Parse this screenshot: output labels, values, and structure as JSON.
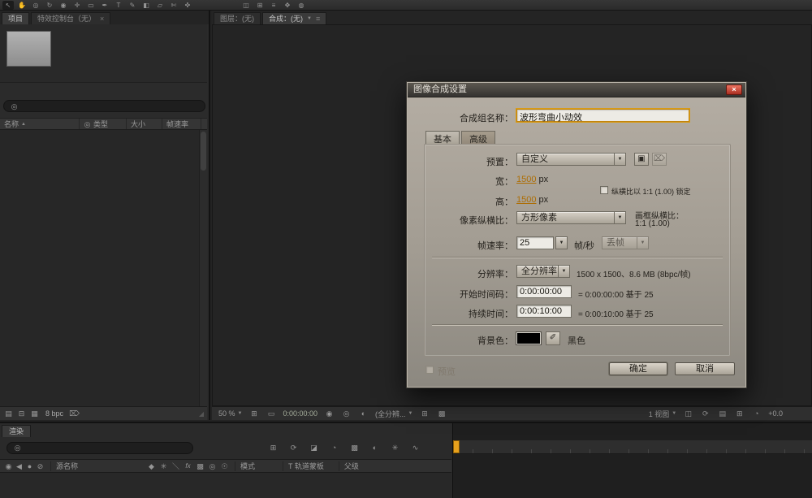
{
  "ui": {
    "dropdown_arrow": "▼",
    "sort_asc": "▲",
    "close_glyph": "×",
    "search_glyph": "◎",
    "panel_menu_glyph": "≡",
    "grip_glyph": "◢",
    "save_glyph": "▣",
    "trash_glyph": "⌦"
  },
  "toolbar": {
    "tools": [
      {
        "glyph": "↖"
      },
      {
        "glyph": "✋"
      },
      {
        "glyph": "◎"
      },
      {
        "glyph": "↻"
      },
      {
        "glyph": "◉"
      },
      {
        "glyph": "✛"
      },
      {
        "glyph": "▭"
      },
      {
        "glyph": "✒"
      },
      {
        "glyph": "T"
      },
      {
        "glyph": "✎"
      },
      {
        "glyph": "◧"
      },
      {
        "glyph": "▱"
      },
      {
        "glyph": "✄"
      },
      {
        "glyph": "✜"
      }
    ],
    "extras": [
      {
        "glyph": "◫"
      },
      {
        "glyph": "⊞"
      },
      {
        "glyph": "≡"
      },
      {
        "glyph": "✥"
      },
      {
        "glyph": "◍"
      }
    ]
  },
  "project": {
    "tab_label": "项目",
    "effect_tab_label": "特效控制台（无）",
    "columns": [
      "名称",
      "类型",
      "大小",
      "帧速率"
    ],
    "bpc_label": "8 bpc",
    "bottom_icons": [
      {
        "glyph": "▤"
      },
      {
        "glyph": "⊟"
      },
      {
        "glyph": "▦"
      },
      {
        "glyph": "⌦"
      }
    ]
  },
  "viewer": {
    "layer_tab": "图层：(无)",
    "comp_tab": "合成：(无)",
    "zoom": "50 %",
    "timecode": "0:00:00:00",
    "resolution": "(全分辨...",
    "view_layout": "1 视图",
    "exposure": "+0.0"
  },
  "dialog": {
    "title": "图像合成设置",
    "name_label": "合成组名称：",
    "name_value": "波形弯曲小动效",
    "tab_basic": "基本",
    "tab_advanced": "高级",
    "preset_label": "预置：",
    "preset_value": "自定义",
    "width_label": "宽：",
    "width_value": "1500",
    "width_unit": "px",
    "lock_label": "纵横比以 1:1 (1.00) 锁定",
    "height_label": "高：",
    "height_value": "1500",
    "height_unit": "px",
    "par_label": "像素纵横比：",
    "par_value": "方形像素",
    "frame_ar_label": "画框纵横比：",
    "frame_ar_value": "1:1 (1.00)",
    "fps_label": "帧速率：",
    "fps_value": "25",
    "fps_unit": "帧/秒",
    "dropframe_value": "丢帧",
    "res_label": "分辨率：",
    "res_value": "全分辨率",
    "res_info": "1500 x 1500、8.6 MB (8bpc/帧)",
    "start_label": "开始时间码：",
    "start_value": "0:00:00:00",
    "start_info": "= 0:00:00:00 基于 25",
    "dur_label": "持续时间：",
    "dur_value": "0:00:10:00",
    "dur_info": "= 0:00:10:00 基于 25",
    "bg_label": "背景色：",
    "bg_name": "黑色",
    "eyedropper_glyph": "✐",
    "preview_label": "预览",
    "ok_label": "确定",
    "cancel_label": "取消"
  },
  "timeline": {
    "tab_label": "渲染",
    "source_name_col": "源名称",
    "mode_col": "模式",
    "track_matte_col": "T 轨道蒙板",
    "parent_col": "父级",
    "toolbar_icons": [
      {
        "glyph": "⊞"
      },
      {
        "glyph": "⟳"
      },
      {
        "glyph": "◪"
      },
      {
        "glyph": "◔"
      },
      {
        "glyph": "▩"
      },
      {
        "glyph": "◐"
      },
      {
        "glyph": "✳"
      },
      {
        "glyph": "∿"
      }
    ],
    "av_icons": [
      {
        "glyph": "◉"
      },
      {
        "glyph": "◀"
      },
      {
        "glyph": "●"
      },
      {
        "glyph": "⊘"
      }
    ],
    "switch_icons": [
      {
        "glyph": "◆"
      },
      {
        "glyph": "✳"
      },
      {
        "glyph": "＼"
      },
      {
        "glyph": "fx"
      },
      {
        "glyph": "▩"
      },
      {
        "glyph": "◎"
      },
      {
        "glyph": "☉"
      }
    ]
  }
}
